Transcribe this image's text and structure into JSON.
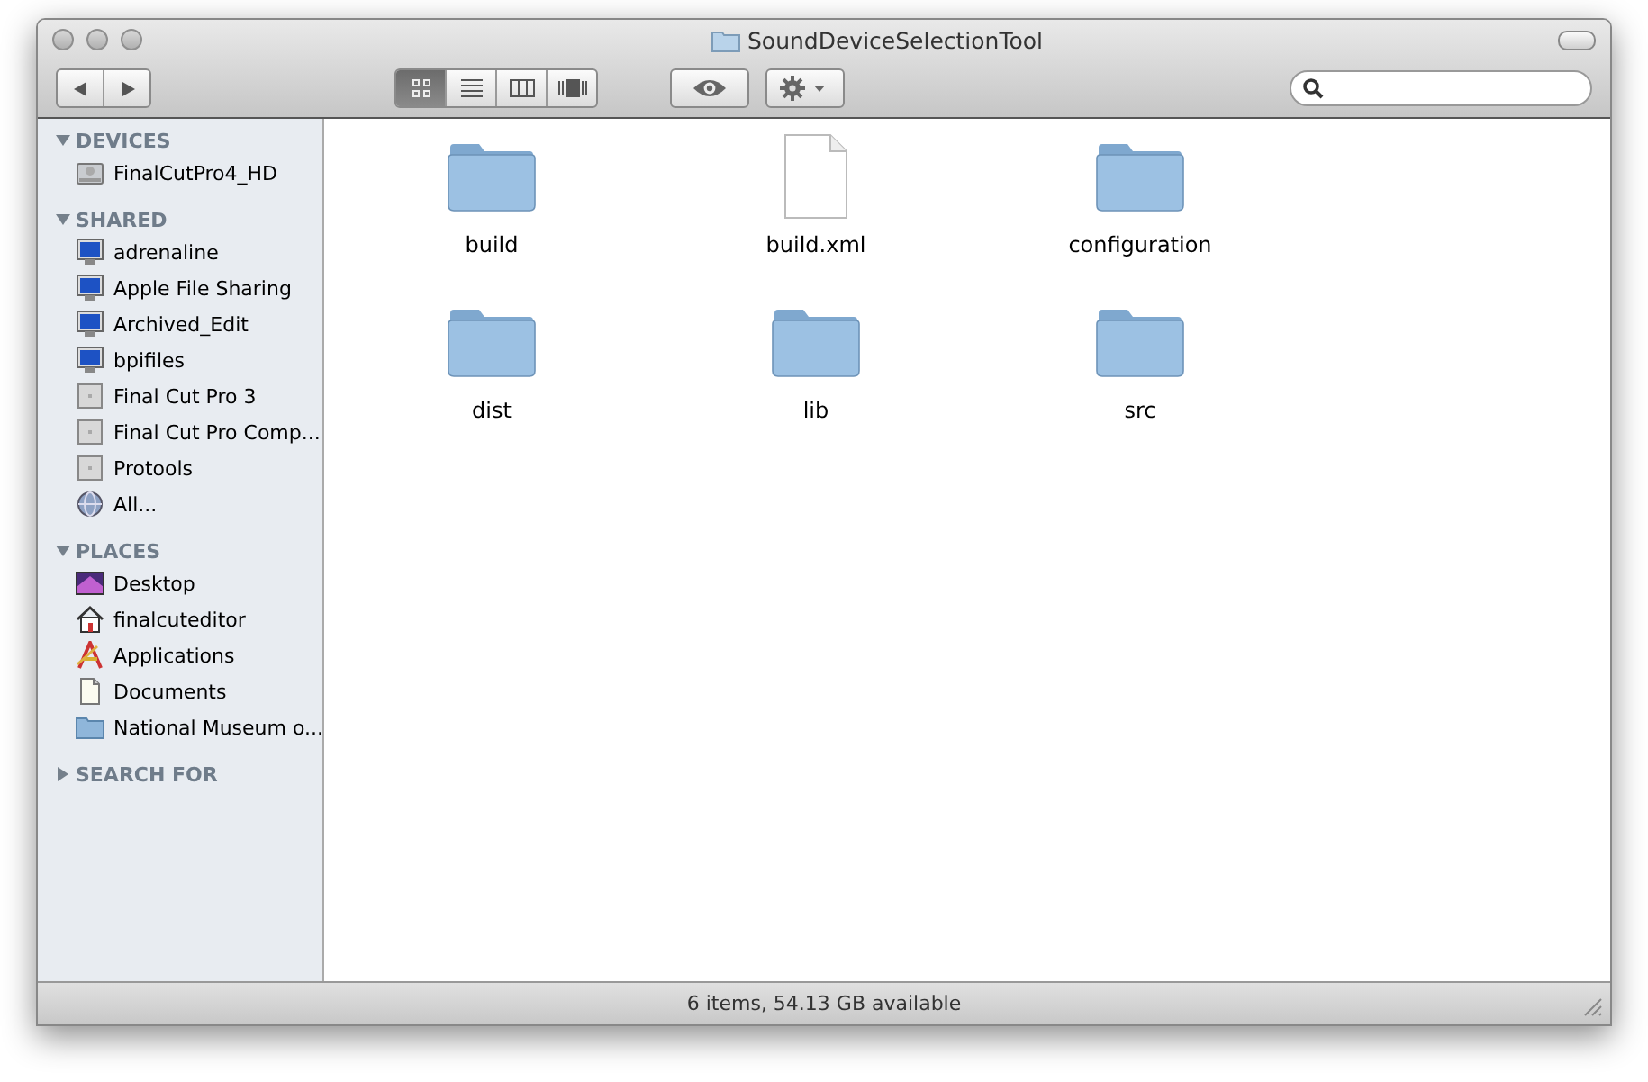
{
  "window": {
    "title": "SoundDeviceSelectionTool"
  },
  "toolbar": {
    "view_modes": [
      {
        "kind": "icon",
        "selected": true
      },
      {
        "kind": "list",
        "selected": false
      },
      {
        "kind": "columns",
        "selected": false
      },
      {
        "kind": "coverflow",
        "selected": false
      }
    ]
  },
  "sidebar": {
    "sections": [
      {
        "title": "DEVICES",
        "expanded": true,
        "items": [
          {
            "label": "FinalCutPro4_HD",
            "kind": "disk"
          }
        ]
      },
      {
        "title": "SHARED",
        "expanded": true,
        "items": [
          {
            "label": "adrenaline",
            "kind": "screen"
          },
          {
            "label": "Apple File Sharing",
            "kind": "screen"
          },
          {
            "label": "Archived_Edit",
            "kind": "screen"
          },
          {
            "label": "bpifiles",
            "kind": "screen"
          },
          {
            "label": "Final Cut Pro 3",
            "kind": "server"
          },
          {
            "label": "Final Cut Pro Comp...",
            "kind": "server"
          },
          {
            "label": "Protools",
            "kind": "server"
          },
          {
            "label": "All...",
            "kind": "globe"
          }
        ]
      },
      {
        "title": "PLACES",
        "expanded": true,
        "items": [
          {
            "label": "Desktop",
            "kind": "desktop"
          },
          {
            "label": "finalcuteditor",
            "kind": "home"
          },
          {
            "label": "Applications",
            "kind": "apps"
          },
          {
            "label": "Documents",
            "kind": "document"
          },
          {
            "label": "National Museum o...",
            "kind": "folder"
          }
        ]
      },
      {
        "title": "SEARCH FOR",
        "expanded": false
      }
    ]
  },
  "files": [
    {
      "name": "build",
      "kind": "folder"
    },
    {
      "name": "build.xml",
      "kind": "file"
    },
    {
      "name": "configuration",
      "kind": "folder"
    },
    {
      "name": "dist",
      "kind": "folder"
    },
    {
      "name": "lib",
      "kind": "folder"
    },
    {
      "name": "src",
      "kind": "folder"
    }
  ],
  "status_bar": "6 items, 54.13 GB available"
}
